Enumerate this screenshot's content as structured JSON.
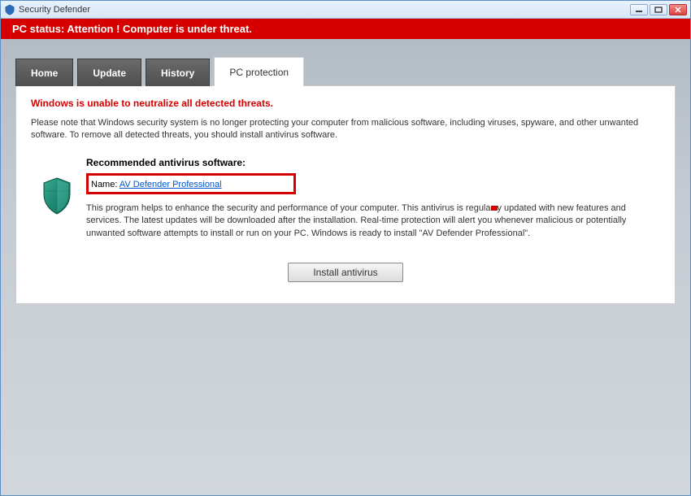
{
  "window": {
    "title": "Security Defender"
  },
  "status": {
    "text": "PC status: Attention ! Computer is under threat."
  },
  "tabs": [
    {
      "label": "Home"
    },
    {
      "label": "Update"
    },
    {
      "label": "History"
    },
    {
      "label": "PC protection"
    }
  ],
  "panel": {
    "warning_title": "Windows is unable to neutralize all detected threats.",
    "warning_desc": "Please note that Windows security system is no longer protecting your computer from malicious software, including viruses, spyware, and other unwanted software. To remove all detected threats, you should install antivirus software.",
    "rec_heading": "Recommended antivirus software:",
    "name_label": "Name: ",
    "product_link": "AV Defender Professional",
    "rec_desc_1": "This program helps to enhance the security and performance of your computer. This antivirus is regula",
    "rec_desc_2": "y updated with new features and services. The latest updates will be downloaded after the installation. Real-time protection will alert you whenever malicious or potentially unwanted software attempts to install or run on your PC. Windows is ready to install \"AV Defender Professional\".",
    "install_button": "Install antivirus"
  }
}
